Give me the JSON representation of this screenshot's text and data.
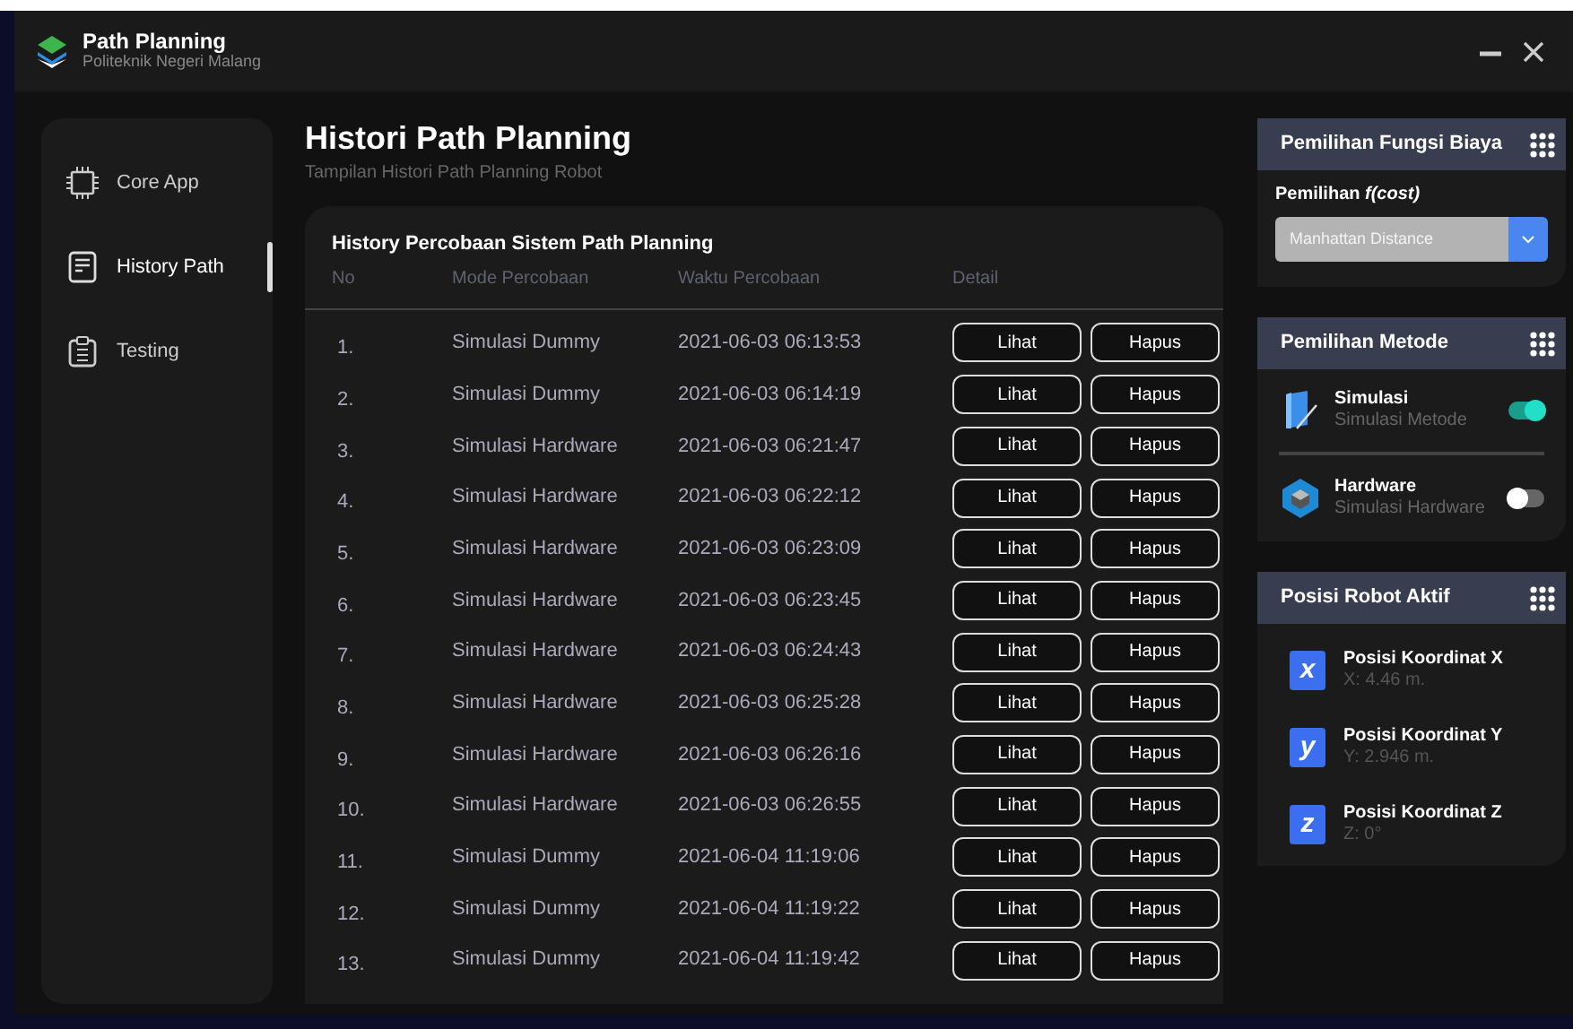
{
  "window": {
    "title": "Path Planning",
    "subtitle": "Politeknik Negeri Malang"
  },
  "sidebar": {
    "items": [
      {
        "label": "Core App",
        "kind": "chip",
        "selected": false
      },
      {
        "label": "History Path",
        "kind": "document",
        "selected": true
      },
      {
        "label": "Testing",
        "kind": "clipboard",
        "selected": false
      }
    ]
  },
  "page": {
    "title": "Histori Path Planning",
    "subtitle": "Tampilan Histori Path Planning Robot"
  },
  "table": {
    "title": "History Percobaan Sistem Path Planning",
    "columns": [
      "No",
      "Mode Percobaan",
      "Waktu Percobaan",
      "Detail"
    ],
    "rows": [
      {
        "no": "1.",
        "mode": "Simulasi Dummy",
        "time": "2021-06-03 06:13:53",
        "actions": [
          "Lihat",
          "Hapus"
        ]
      },
      {
        "no": "2.",
        "mode": "Simulasi Dummy",
        "time": "2021-06-03 06:14:19",
        "actions": [
          "Lihat",
          "Hapus"
        ]
      },
      {
        "no": "3.",
        "mode": "Simulasi Hardware",
        "time": "2021-06-03 06:21:47",
        "actions": [
          "Lihat",
          "Hapus"
        ]
      },
      {
        "no": "4.",
        "mode": "Simulasi Hardware",
        "time": "2021-06-03 06:22:12",
        "actions": [
          "Lihat",
          "Hapus"
        ]
      },
      {
        "no": "5.",
        "mode": "Simulasi Hardware",
        "time": "2021-06-03 06:23:09",
        "actions": [
          "Lihat",
          "Hapus"
        ]
      },
      {
        "no": "6.",
        "mode": "Simulasi Hardware",
        "time": "2021-06-03 06:23:45",
        "actions": [
          "Lihat",
          "Hapus"
        ]
      },
      {
        "no": "7.",
        "mode": "Simulasi Hardware",
        "time": "2021-06-03 06:24:43",
        "actions": [
          "Lihat",
          "Hapus"
        ]
      },
      {
        "no": "8.",
        "mode": "Simulasi Hardware",
        "time": "2021-06-03 06:25:28",
        "actions": [
          "Lihat",
          "Hapus"
        ]
      },
      {
        "no": "9.",
        "mode": "Simulasi Hardware",
        "time": "2021-06-03 06:26:16",
        "actions": [
          "Lihat",
          "Hapus"
        ]
      },
      {
        "no": "10.",
        "mode": "Simulasi Hardware",
        "time": "2021-06-03 06:26:55",
        "actions": [
          "Lihat",
          "Hapus"
        ]
      },
      {
        "no": "11.",
        "mode": "Simulasi Dummy",
        "time": "2021-06-04 11:19:06",
        "actions": [
          "Lihat",
          "Hapus"
        ]
      },
      {
        "no": "12.",
        "mode": "Simulasi Dummy",
        "time": "2021-06-04 11:19:22",
        "actions": [
          "Lihat",
          "Hapus"
        ]
      },
      {
        "no": "13.",
        "mode": "Simulasi Dummy",
        "time": "2021-06-04 11:19:42",
        "actions": [
          "Lihat",
          "Hapus"
        ]
      }
    ]
  },
  "cost_panel": {
    "title": "Pemilihan Fungsi Biaya",
    "label": "Pemilihan *f(cost)*",
    "select_value": "Manhattan Distance"
  },
  "method_panel": {
    "title": "Pemilihan Metode",
    "methods": [
      {
        "name": "Simulasi",
        "description": "Simulasi Metode",
        "kind": "simulation",
        "on": true
      },
      {
        "name": "Hardware",
        "description": "Simulasi Hardware",
        "kind": "hardware",
        "on": false
      }
    ]
  },
  "position_panel": {
    "title": "Posisi Robot Aktif",
    "coordinates": [
      {
        "badge": "x",
        "title": "Posisi Koordinat X",
        "value": "X: 4.46 m."
      },
      {
        "badge": "y",
        "title": "Posisi Koordinat Y",
        "value": "Y: 2.946 m."
      },
      {
        "badge": "z",
        "title": "Posisi Koordinat Z",
        "value": "Z: 0°"
      }
    ]
  }
}
